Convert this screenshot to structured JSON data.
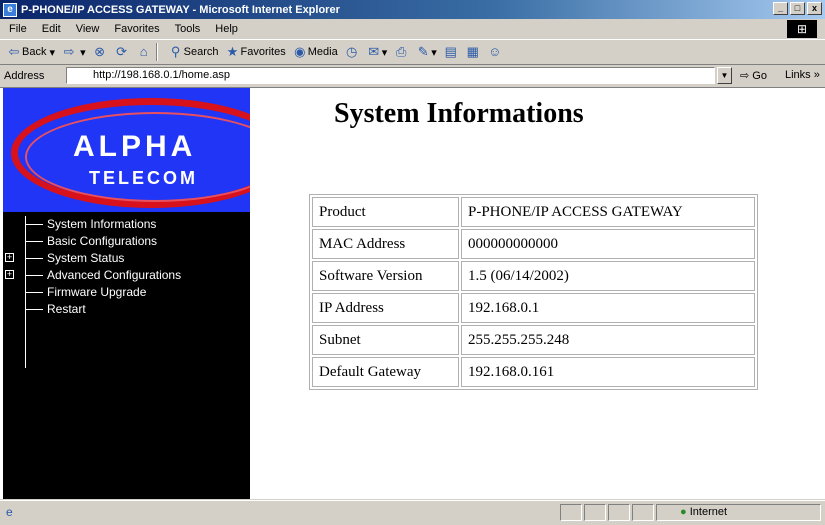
{
  "window": {
    "title": "P-PHONE/IP ACCESS GATEWAY - Microsoft Internet Explorer",
    "controls": {
      "minimize": "_",
      "maximize": "□",
      "close": "x"
    }
  },
  "menu": {
    "items": [
      "File",
      "Edit",
      "View",
      "Favorites",
      "Tools",
      "Help"
    ]
  },
  "toolbar": {
    "back": "Back",
    "search": "Search",
    "favorites": "Favorites",
    "media": "Media"
  },
  "address": {
    "label": "Address",
    "url": "http://198.168.0.1/home.asp",
    "go": "Go",
    "links": "Links »"
  },
  "logo": {
    "line1": "ALPHA",
    "line2": "TELECOM"
  },
  "sidebar": {
    "items": [
      {
        "label": "System Informations",
        "expandable": false
      },
      {
        "label": "Basic Configurations",
        "expandable": false
      },
      {
        "label": "System Status",
        "expandable": true
      },
      {
        "label": "Advanced Configurations",
        "expandable": true
      },
      {
        "label": "Firmware Upgrade",
        "expandable": false
      },
      {
        "label": "Restart",
        "expandable": false
      }
    ]
  },
  "main": {
    "title": "System Informations",
    "rows": [
      {
        "key": "Product",
        "value": "P-PHONE/IP ACCESS GATEWAY"
      },
      {
        "key": "MAC Address",
        "value": "000000000000"
      },
      {
        "key": "Software Version",
        "value": "1.5 (06/14/2002)"
      },
      {
        "key": "IP Address",
        "value": "192.168.0.1"
      },
      {
        "key": "Subnet",
        "value": "255.255.255.248"
      },
      {
        "key": "Default Gateway",
        "value": "192.168.0.161"
      }
    ]
  },
  "status": {
    "zone": "Internet"
  },
  "colors": {
    "titlebar": "#0a246a",
    "logo_bg": "#2035f5",
    "logo_ring": "#d8121c",
    "sidebar_bg": "#000000"
  }
}
